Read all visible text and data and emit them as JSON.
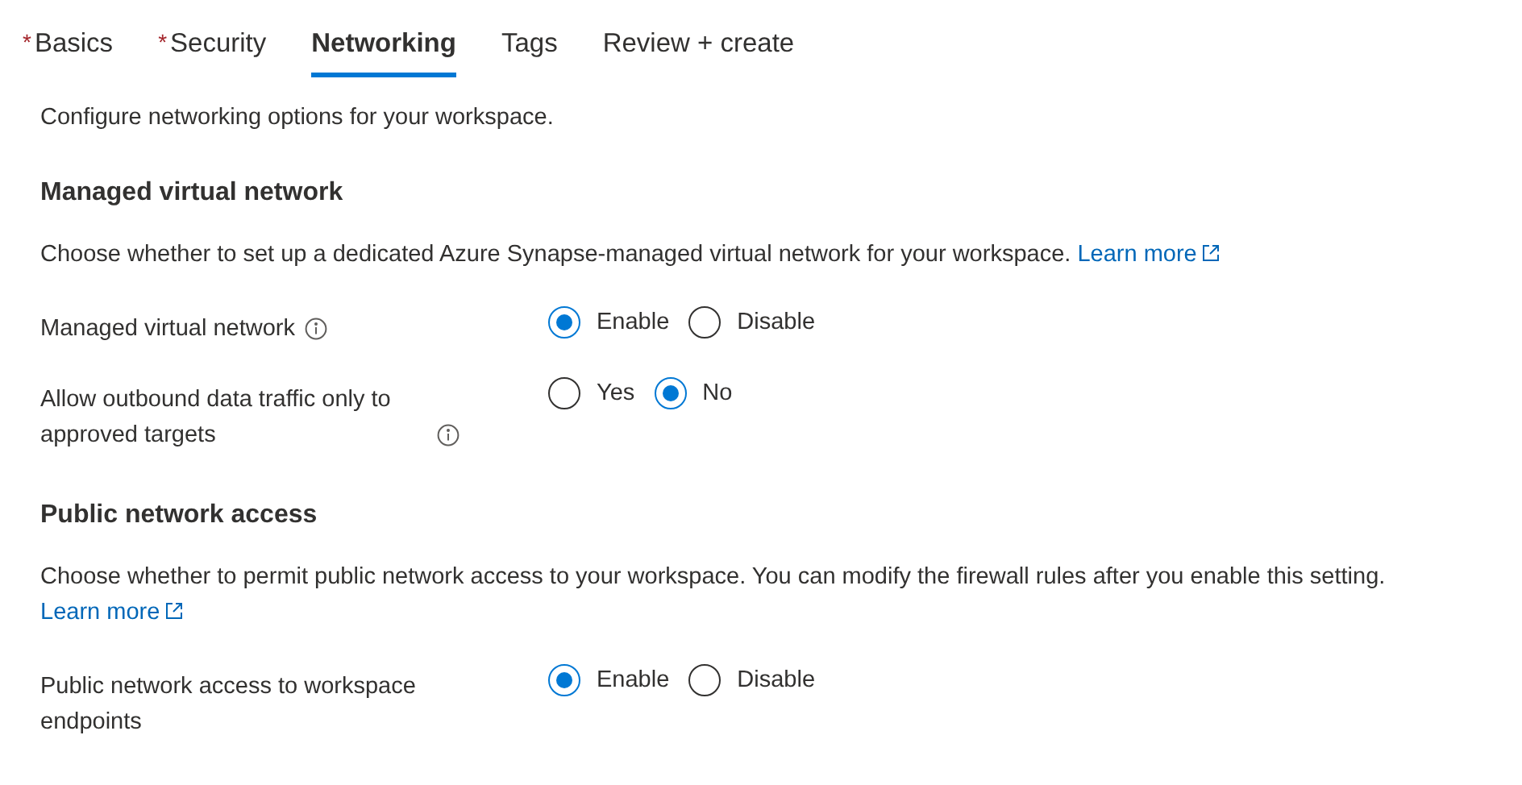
{
  "tabs": [
    {
      "label": "Basics",
      "required_mark": "*",
      "selected": false
    },
    {
      "label": "Security",
      "required_mark": "*",
      "selected": false
    },
    {
      "label": "Networking",
      "selected": true
    },
    {
      "label": "Tags",
      "selected": false
    },
    {
      "label": "Review + create",
      "selected": false
    }
  ],
  "intro": "Configure networking options for your workspace.",
  "sections": [
    {
      "heading": "Managed virtual network",
      "description": "Choose whether to set up a dedicated Azure Synapse-managed virtual network for your workspace.",
      "link": "Learn more",
      "fields": [
        {
          "label": "Managed virtual network",
          "info": true,
          "options": [
            {
              "label": "Enable",
              "selected": true
            },
            {
              "label": "Disable",
              "selected": false
            }
          ]
        },
        {
          "label": "Allow outbound data traffic only to approved targets",
          "info": true,
          "options": [
            {
              "label": "Yes",
              "selected": false
            },
            {
              "label": "No",
              "selected": true
            }
          ]
        }
      ]
    },
    {
      "heading": "Public network access",
      "description": "Choose whether to permit public network access to your workspace. You can modify the firewall rules after you enable this setting.",
      "link": "Learn more",
      "fields": [
        {
          "label": "Public network access to workspace endpoints",
          "info": false,
          "options": [
            {
              "label": "Enable",
              "selected": true
            },
            {
              "label": "Disable",
              "selected": false
            }
          ]
        }
      ]
    }
  ]
}
